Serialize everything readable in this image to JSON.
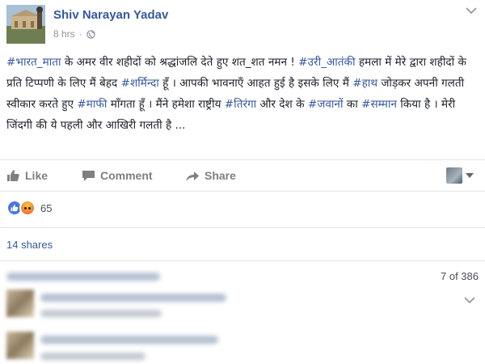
{
  "post": {
    "author": "Shiv Narayan Yadav",
    "time": "8 hrs",
    "privacy_icon": "globe-icon",
    "text_segments": [
      {
        "t": "#भारत_माता",
        "tag": true
      },
      {
        "t": " के अमर वीर शहीदों को श्रद्धांजलि देते हुए शत_शत नमन ! ",
        "tag": false
      },
      {
        "t": "#उरी_आतंकी",
        "tag": true
      },
      {
        "t": " हमला में मेरे द्वारा शहीदों के प्रति टिप्पणी के लिए मैं बेहद ",
        "tag": false
      },
      {
        "t": "#शर्मिन्दा",
        "tag": true
      },
      {
        "t": " हूँ । आपकी भावनाएँ आहत हुई है इसके लिए मैं ",
        "tag": false
      },
      {
        "t": "#हाथ",
        "tag": true
      },
      {
        "t": " जोड़कर अपनी गलती स्वीकार करते हुए ",
        "tag": false
      },
      {
        "t": "#माफी",
        "tag": true
      },
      {
        "t": " माँगता हूँ । मैंने हमेशा राष्ट्रीय ",
        "tag": false
      },
      {
        "t": "#तिरंगा",
        "tag": true
      },
      {
        "t": " और देश के ",
        "tag": false
      },
      {
        "t": "#जवानों",
        "tag": true
      },
      {
        "t": " का ",
        "tag": false
      },
      {
        "t": "#सम्मान",
        "tag": true
      },
      {
        "t": " किया है । मेरी जिंदगी की ये पहली और आखिरी गलती है ...",
        "tag": false
      }
    ]
  },
  "actions": {
    "like": "Like",
    "comment": "Comment",
    "share": "Share"
  },
  "reactions": {
    "count": "65",
    "types": [
      "like-reaction-icon",
      "angry-reaction-icon"
    ]
  },
  "shares": "14 shares",
  "comments": {
    "pager": "7 of 386"
  },
  "colors": {
    "link": "#365899",
    "muted": "#90949c",
    "action": "#7f7f7f",
    "border": "#e5e5e5"
  }
}
